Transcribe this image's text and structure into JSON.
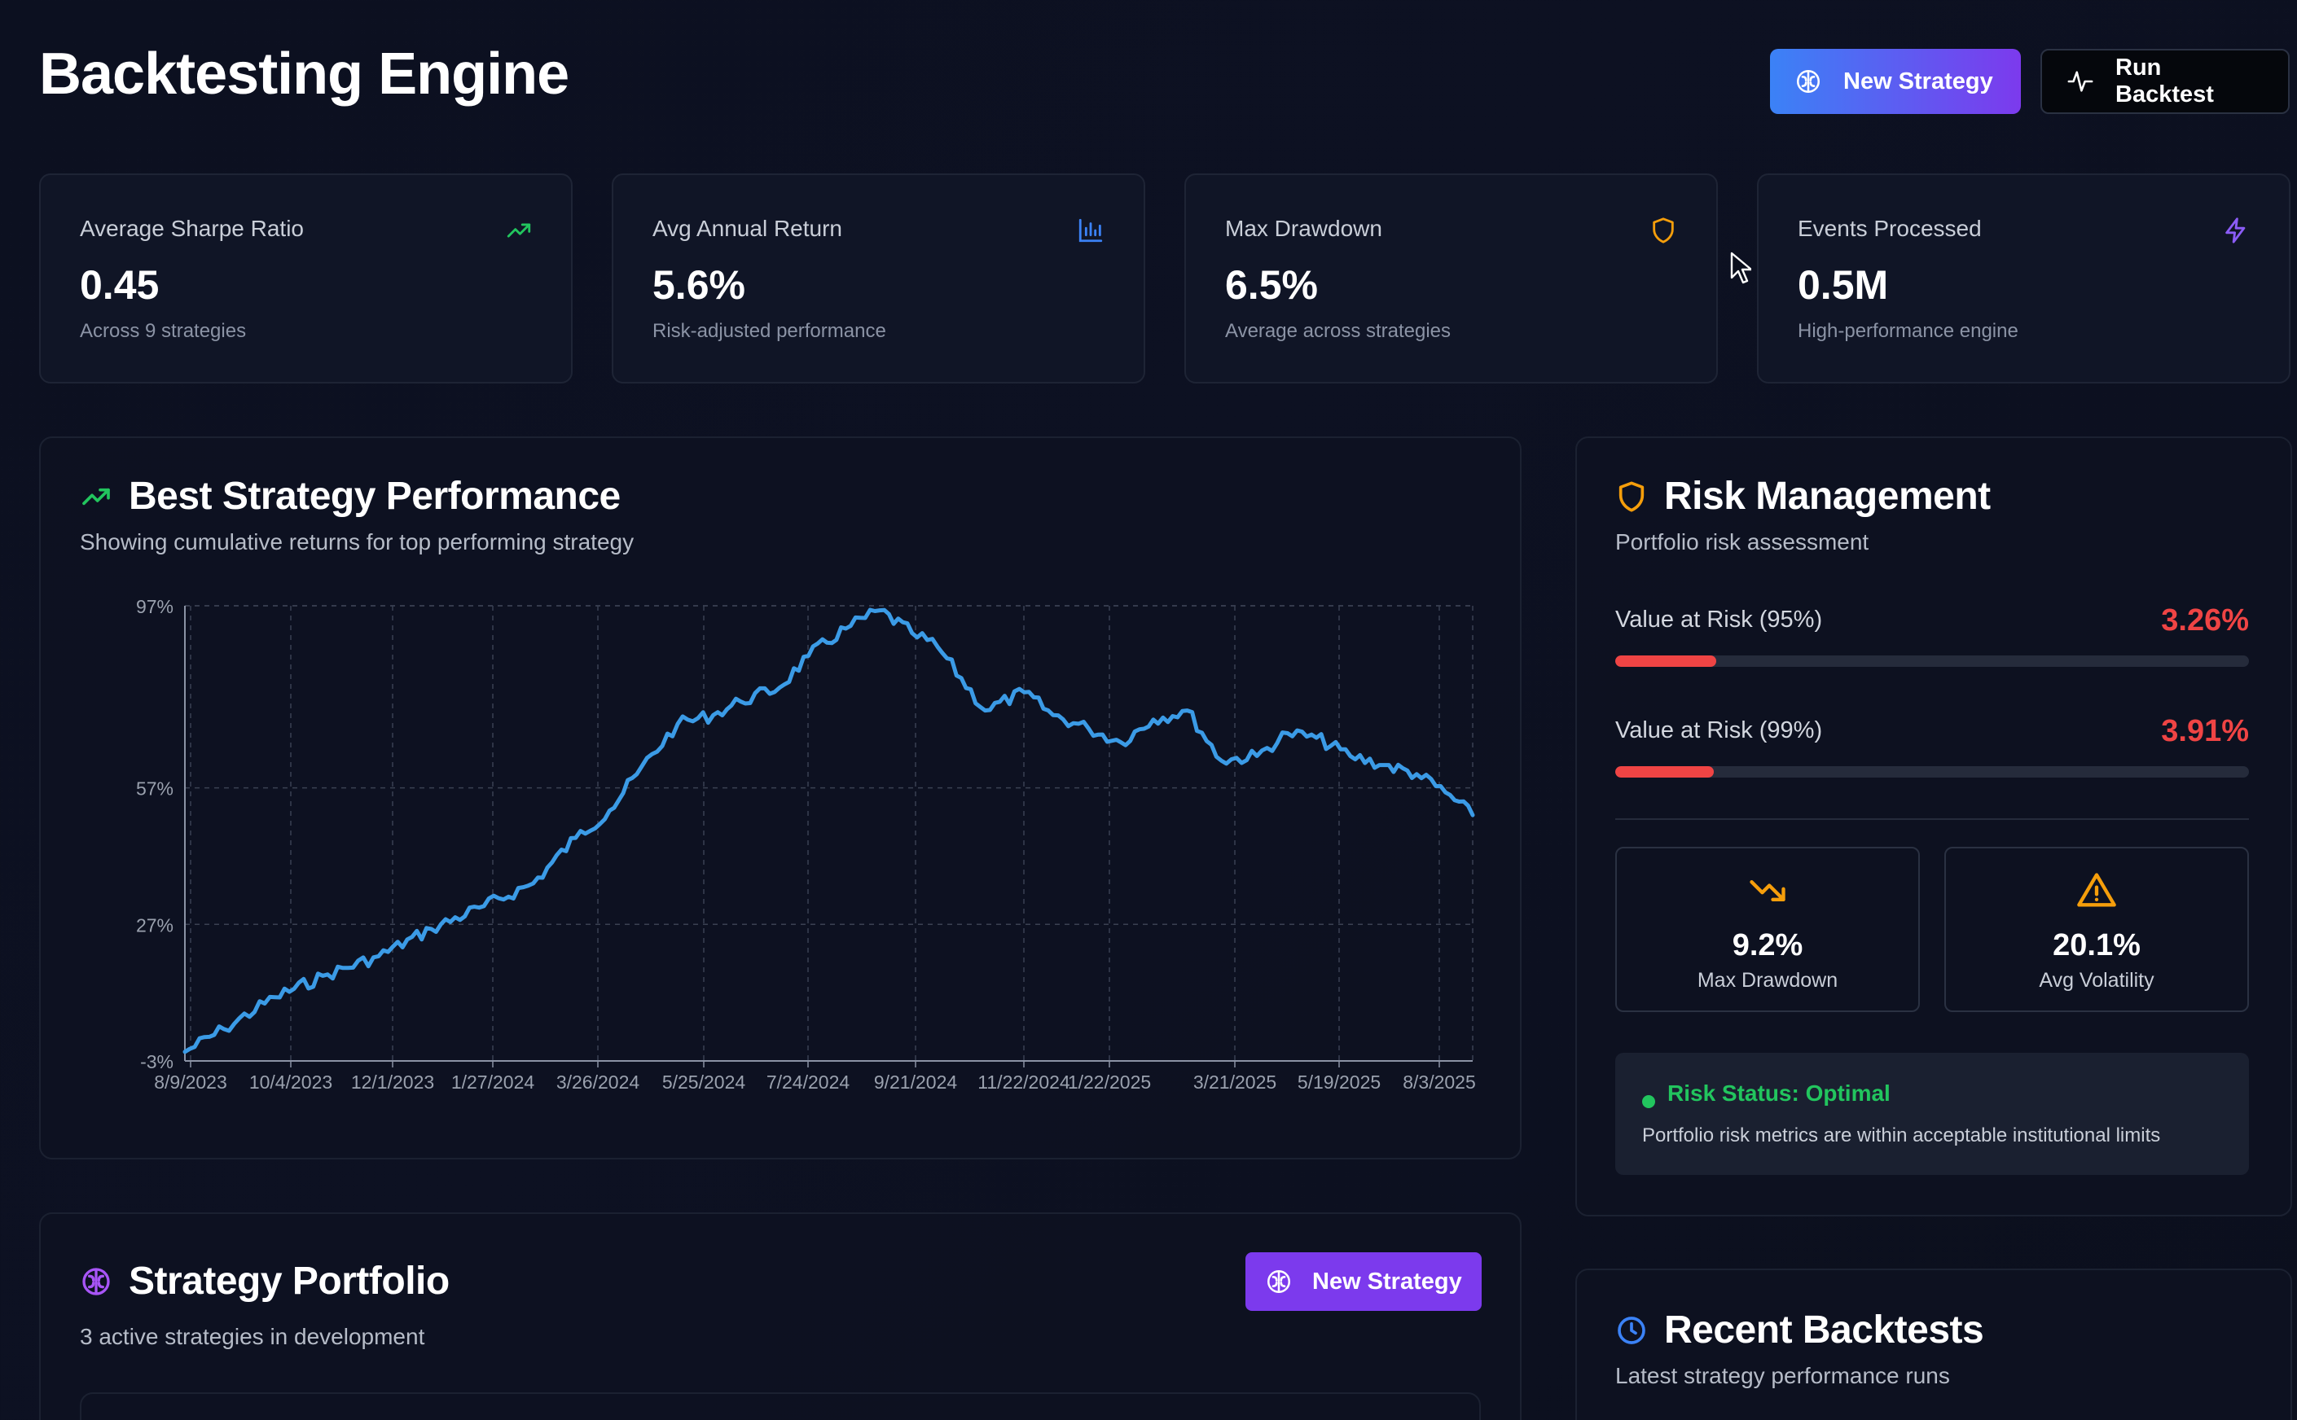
{
  "header": {
    "title": "Backtesting Engine",
    "new_strategy_label": "New Strategy",
    "run_backtest_label": "Run Backtest"
  },
  "stats": [
    {
      "label": "Average Sharpe Ratio",
      "value": "0.45",
      "sub": "Across 9 strategies",
      "icon": "trending-up-icon",
      "color": "#22c55e"
    },
    {
      "label": "Avg Annual Return",
      "value": "5.6%",
      "sub": "Risk-adjusted performance",
      "icon": "bar-chart-icon",
      "color": "#3b82f6"
    },
    {
      "label": "Max Drawdown",
      "value": "6.5%",
      "sub": "Average across strategies",
      "icon": "shield-icon",
      "color": "#f59e0b"
    },
    {
      "label": "Events Processed",
      "value": "0.5M",
      "sub": "High-performance engine",
      "icon": "zap-icon",
      "color": "#8b5cf6"
    }
  ],
  "performance": {
    "title": "Best Strategy Performance",
    "subtitle": "Showing cumulative returns for top performing strategy"
  },
  "chart_data": {
    "type": "line",
    "title": "",
    "xlabel": "",
    "ylabel": "",
    "x_tick_labels": [
      "8/9/2023",
      "10/4/2023",
      "12/1/2023",
      "1/27/2024",
      "3/26/2024",
      "5/25/2024",
      "7/24/2024",
      "9/21/2024",
      "11/22/2024",
      "1/22/2025",
      "3/21/2025",
      "5/19/2025",
      "8/3/2025"
    ],
    "y_tick_labels": [
      "-3%",
      "27%",
      "57%",
      "97%"
    ],
    "y_ticks": [
      -3,
      27,
      57,
      97
    ],
    "ylim": [
      -3,
      97
    ],
    "xlim": [
      "2023-08-09",
      "2025-09-05"
    ],
    "grid": true,
    "color": "#3b9be6",
    "series": [
      {
        "x": [
          "2023-08-09",
          "2023-09-01",
          "2023-10-01",
          "2023-11-01",
          "2023-12-01",
          "2024-01-01",
          "2024-02-01",
          "2024-03-01",
          "2024-03-26",
          "2024-04-15",
          "2024-05-01",
          "2024-05-25",
          "2024-06-15",
          "2024-07-01",
          "2024-07-24",
          "2024-08-10",
          "2024-09-01",
          "2024-09-21",
          "2024-10-10",
          "2024-10-25",
          "2024-11-22",
          "2024-12-15",
          "2025-01-01",
          "2025-01-22",
          "2025-02-10",
          "2025-03-01",
          "2025-03-21",
          "2025-04-10",
          "2025-05-01",
          "2025-05-19",
          "2025-06-05",
          "2025-06-25",
          "2025-07-15",
          "2025-08-03",
          "2025-08-20",
          "2025-09-05"
        ],
        "y": [
          -1,
          4,
          11,
          16,
          20,
          26,
          31,
          36,
          46,
          52,
          60,
          71,
          73,
          76,
          79,
          86,
          92,
          96,
          91,
          88,
          74,
          78,
          73,
          70,
          67,
          72,
          74,
          63,
          64,
          69,
          68,
          64,
          62,
          60,
          56,
          51
        ]
      }
    ]
  },
  "risk": {
    "title": "Risk Management",
    "subtitle": "Portfolio risk assessment",
    "var95": {
      "label": "Value at Risk (95%)",
      "value": "3.26%",
      "fill": 0.16
    },
    "var99": {
      "label": "Value at Risk (99%)",
      "value": "3.91%",
      "fill": 0.155
    },
    "max_drawdown": {
      "value": "9.2%",
      "label": "Max Drawdown"
    },
    "avg_volatility": {
      "value": "20.1%",
      "label": "Avg Volatility"
    },
    "status_title": "Risk Status: Optimal",
    "status_text": "Portfolio risk metrics are within acceptable institutional limits",
    "colors": {
      "danger": "#ef4444",
      "ok": "#22c55e",
      "warn": "#f59e0b"
    }
  },
  "portfolio": {
    "title": "Strategy Portfolio",
    "subtitle": "3 active strategies in development",
    "button_label": "New Strategy"
  },
  "recent": {
    "title": "Recent Backtests",
    "subtitle": "Latest strategy performance runs"
  }
}
